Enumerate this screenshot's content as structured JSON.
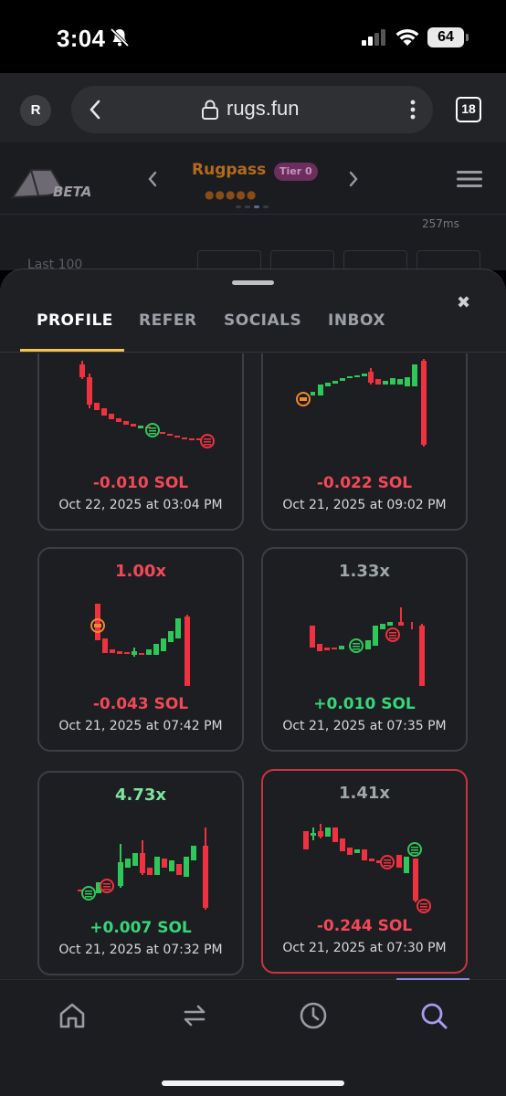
{
  "status": {
    "time": "3:04",
    "battery": "64"
  },
  "browser": {
    "avatar": "R",
    "url": "rugs.fun",
    "tabs": "18"
  },
  "header": {
    "beta": "BETA",
    "rugpass": "Rugpass",
    "tier": "Tier 0",
    "ping": "257ms",
    "last100": "Last 100"
  },
  "tabs": [
    "PROFILE",
    "REFER",
    "SOCIALS",
    "INBOX"
  ],
  "cards": [
    {
      "multiplier": "",
      "pnl": "-0.010 SOL",
      "date": "Oct 22, 2025 at 03:04 PM",
      "pnl_color": "red"
    },
    {
      "multiplier": "",
      "pnl": "-0.022 SOL",
      "date": "Oct 21, 2025 at 09:02 PM",
      "pnl_color": "red"
    },
    {
      "multiplier": "1.00x",
      "pnl": "-0.043 SOL",
      "date": "Oct 21, 2025 at 07:42 PM",
      "pnl_color": "red",
      "mult_color": "red"
    },
    {
      "multiplier": "1.33x",
      "pnl": "+0.010 SOL",
      "date": "Oct 21, 2025 at 07:35 PM",
      "pnl_color": "green",
      "mult_color": "grey"
    },
    {
      "multiplier": "4.73x",
      "pnl": "+0.007 SOL",
      "date": "Oct 21, 2025 at 07:32 PM",
      "pnl_color": "green",
      "mult_color": "lime"
    },
    {
      "multiplier": "1.41x",
      "pnl": "-0.244 SOL",
      "date": "Oct 21, 2025 at 07:30 PM",
      "pnl_color": "red",
      "mult_color": "grey",
      "highlighted": true
    }
  ],
  "colors": {
    "up": "#2fc75a",
    "down": "#f0313f",
    "accent": "#f5c44b",
    "nav_active": "#a79cf0"
  },
  "bottom_nav": [
    "home-icon",
    "swap-icon",
    "history-icon",
    "search-icon"
  ]
}
